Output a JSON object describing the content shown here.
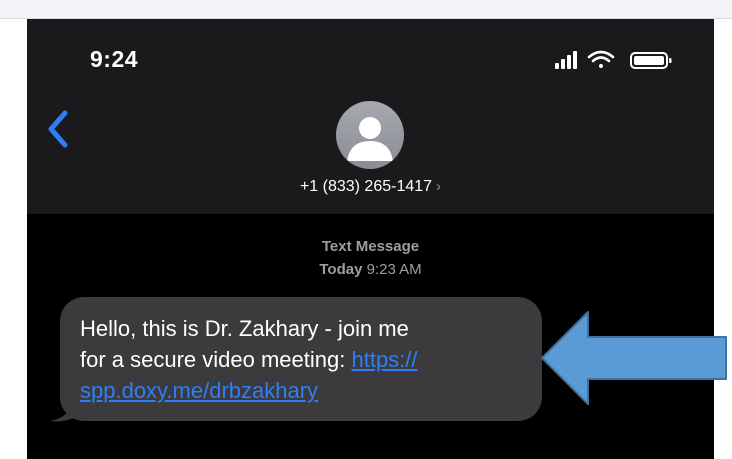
{
  "status_bar": {
    "time": "9:24",
    "icons": [
      "signal-icon",
      "wifi-icon",
      "battery-icon"
    ]
  },
  "conversation": {
    "contact_number": "+1 (833) 265-1417",
    "contact_chevron": "›"
  },
  "thread": {
    "message_type": "Text Message",
    "date_day": "Today",
    "date_time": "9:23 AM"
  },
  "message": {
    "text_line1": "Hello, this is Dr. Zakhary - join me",
    "text_line2_prefix": "for a secure video meeting: ",
    "link_part1": "https://",
    "link_part2": "spp.doxy.me/drbzakhary"
  },
  "colors": {
    "link": "#2f7ef5",
    "bubble": "#3b3b3d",
    "header": "#1a1a1c",
    "annotation_arrow": "#5b9bd5",
    "back_chevron": "#2f7ef5"
  }
}
